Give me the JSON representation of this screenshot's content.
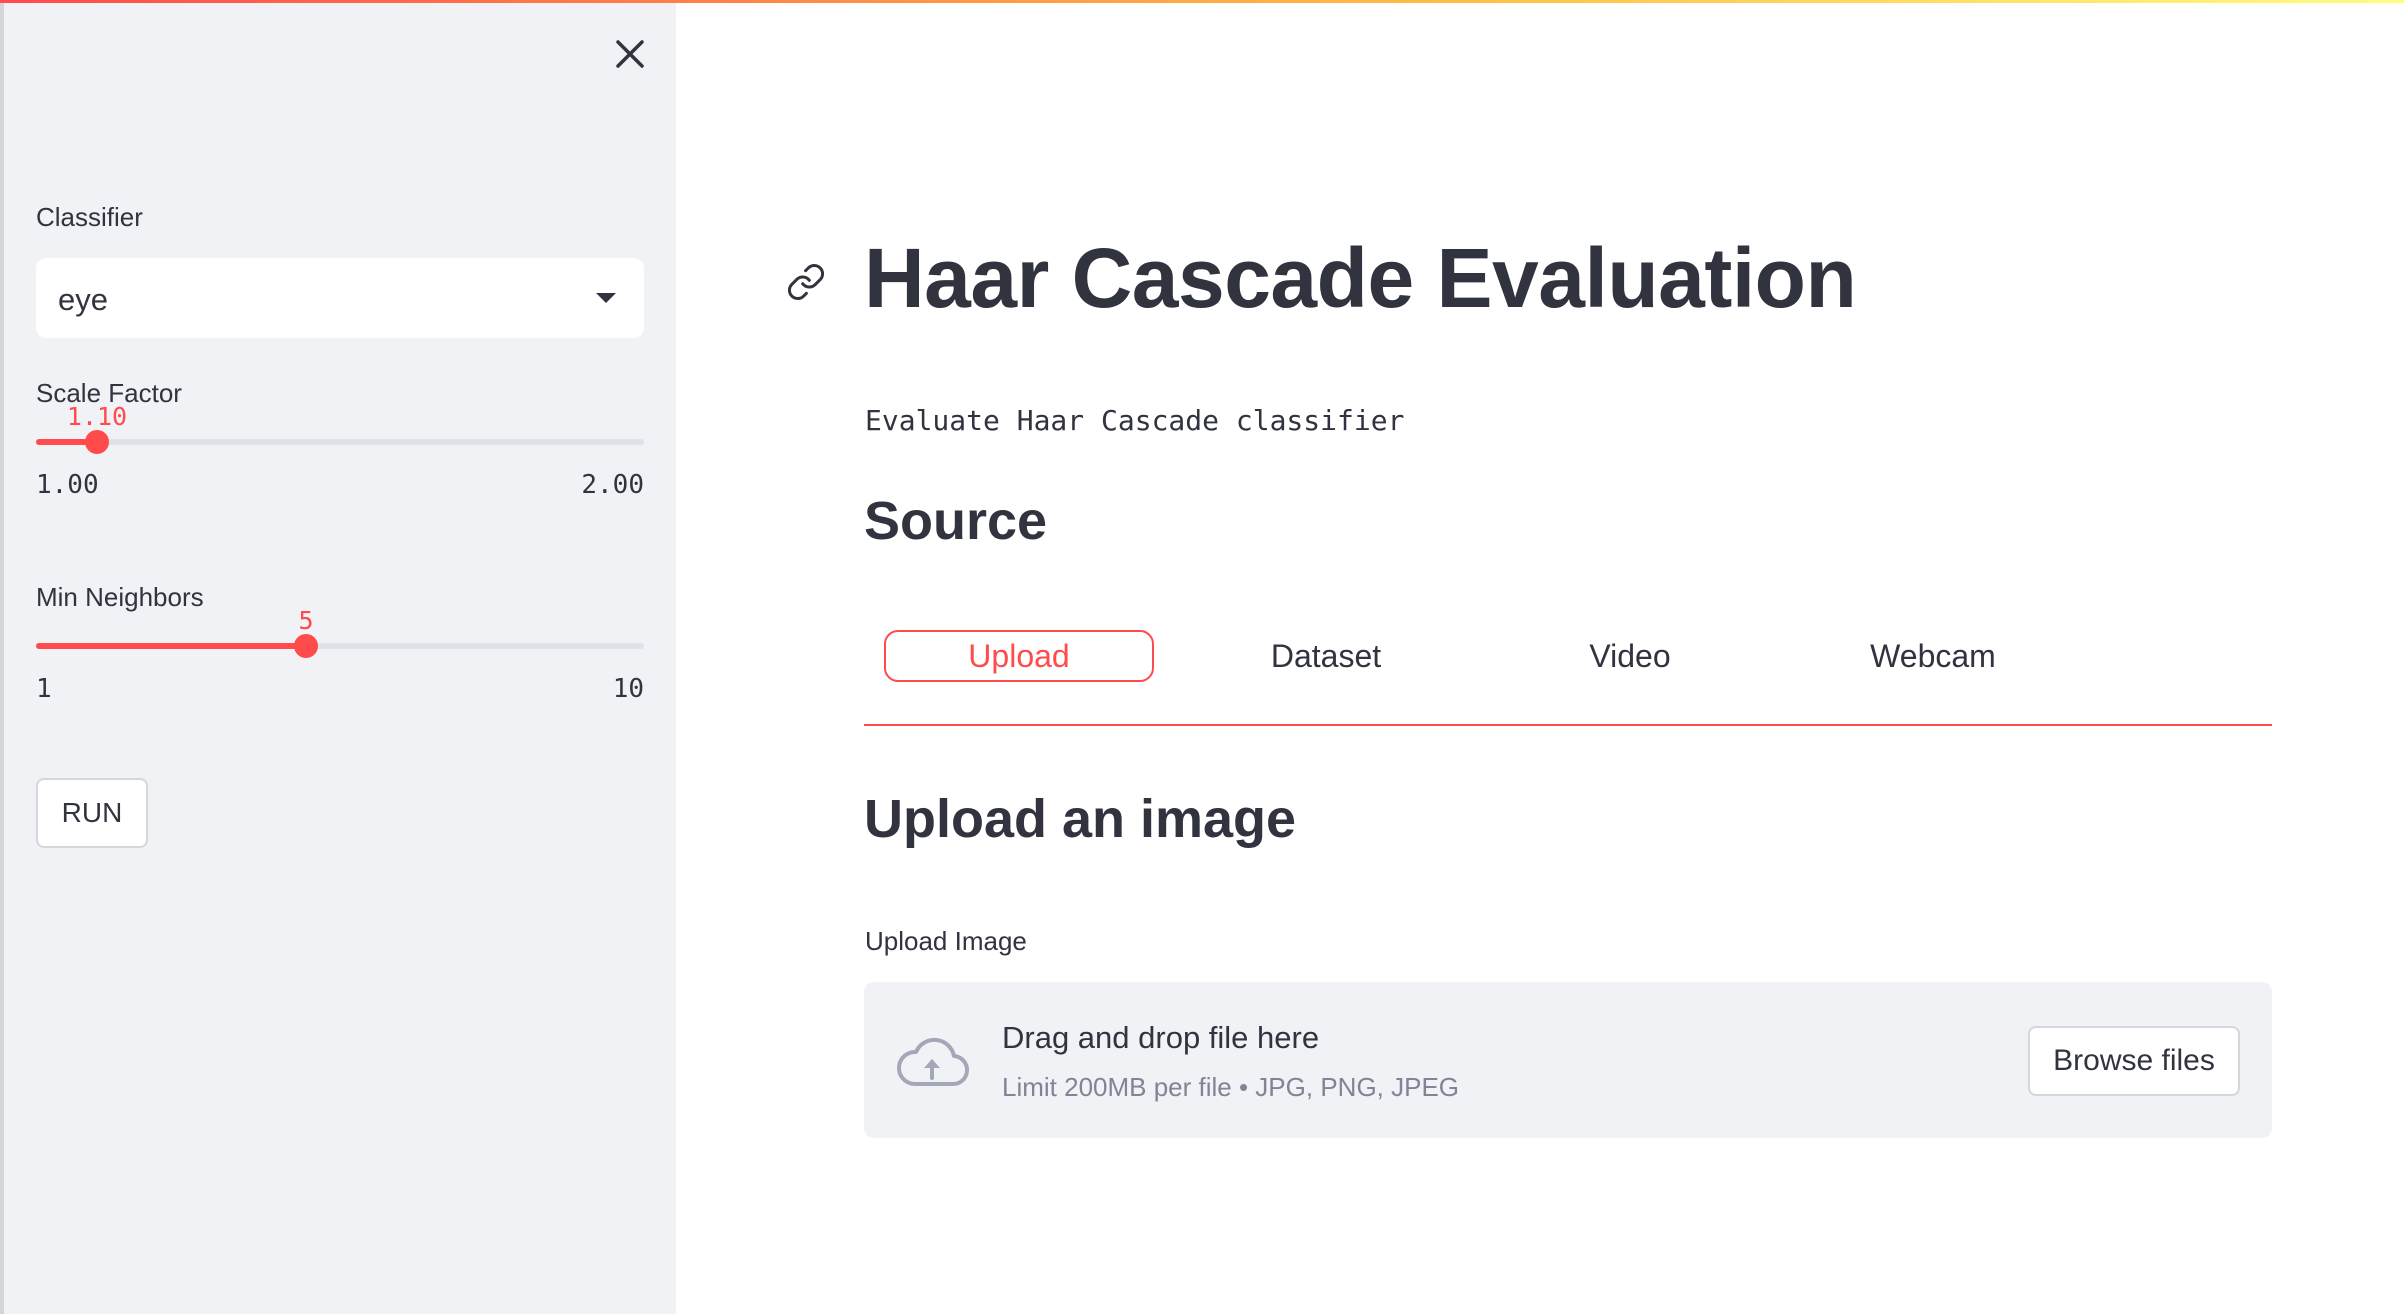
{
  "colors": {
    "primary": "#ff4b4b",
    "text": "#31333f",
    "sidebar_bg": "#f0f2f6",
    "muted": "#808495"
  },
  "sidebar": {
    "close_icon": "close-icon",
    "classifier": {
      "label": "Classifier",
      "value": "eye"
    },
    "scale_factor": {
      "label": "Scale Factor",
      "value": "1.10",
      "min": "1.00",
      "max": "2.00",
      "fraction": 0.1
    },
    "min_neighbors": {
      "label": "Min Neighbors",
      "value": "5",
      "min": "1",
      "max": "10",
      "fraction": 0.444
    },
    "run_label": "RUN"
  },
  "main": {
    "link_icon": "link-icon",
    "title": "Haar Cascade Evaluation",
    "caption": "Evaluate Haar Cascade classifier",
    "source_heading": "Source",
    "tabs": [
      {
        "label": "Upload",
        "active": true
      },
      {
        "label": "Dataset",
        "active": false
      },
      {
        "label": "Video",
        "active": false
      },
      {
        "label": "Webcam",
        "active": false
      }
    ],
    "upload_heading": "Upload an image",
    "uploader": {
      "label": "Upload Image",
      "icon": "cloud-upload-icon",
      "title": "Drag and drop file here",
      "subtitle": "Limit 200MB per file • JPG, PNG, JPEG",
      "browse_label": "Browse files"
    }
  }
}
